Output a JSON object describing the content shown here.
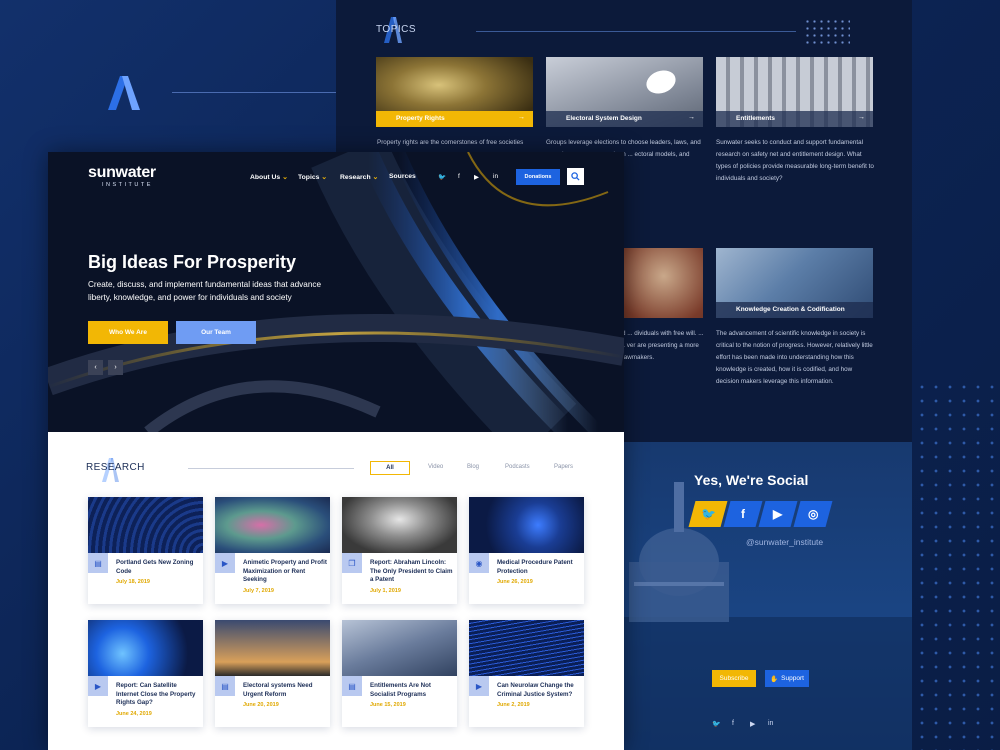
{
  "topics": {
    "heading": "TOPICS",
    "cards": [
      {
        "label": "Property Rights",
        "desc": "Property rights are the cornerstones of free societies"
      },
      {
        "label": "Electoral System Design",
        "desc": "Groups leverage elections to choose leaders, laws, and ... and sponsors research on ... ectoral models, and helps ... stems for the right"
      },
      {
        "label": "Entitlements",
        "desc": "Sunwater seeks to conduct and support fundamental research on safety net and entitlement design. What types of policies provide measurable long-term benefit to individuals and society?"
      },
      {
        "label": "",
        "desc": "... and sentencing are based ... dividuals with free will. ... psychology, genetics, and ... ver are presenting a more ... behavior that has ... and lawmakers."
      },
      {
        "label": "Knowledge Creation & Codification",
        "desc": "The advancement of scientific knowledge in society is critical to the notion of progress. However, relatively little effort has been made into understanding how this knowledge is created, how it is codified, and how decision makers leverage this information."
      }
    ]
  },
  "social": {
    "title": "Yes, We're Social",
    "handle": "@sunwater_institute",
    "subscribe": "Subscribe",
    "support": "Support",
    "buttons": [
      {
        "icon": "twitter-icon",
        "glyph": "🐦",
        "color": "#f2b705"
      },
      {
        "icon": "facebook-icon",
        "glyph": "f",
        "color": "#1d63e0"
      },
      {
        "icon": "youtube-icon",
        "glyph": "▶",
        "color": "#1d63e0"
      },
      {
        "icon": "instagram-icon",
        "glyph": "◎",
        "color": "#1d63e0"
      }
    ]
  },
  "site": {
    "logo_main": "sunwater",
    "logo_sub": "INSTITUTE",
    "nav": [
      "About Us",
      "Topics",
      "Research",
      "Sources"
    ],
    "donate": "Donations"
  },
  "hero": {
    "title": "Big Ideas For Prosperity",
    "subtitle": "Create, discuss, and implement fundamental ideas that advance liberty, knowledge, and power for individuals and society",
    "btn_primary": "Who We Are",
    "btn_secondary": "Our Team"
  },
  "research": {
    "heading": "RESEARCH",
    "filters": [
      "All",
      "Video",
      "Blog",
      "Podcasts",
      "Papers"
    ],
    "cards": [
      {
        "title": "Portland Gets New Zoning Code",
        "date": "July 18, 2019",
        "icon": "document-icon"
      },
      {
        "title": "Animetic Property and Profit Maximization or Rent Seeking",
        "date": "July 7, 2019",
        "icon": "play-icon"
      },
      {
        "title": "Report: Abraham Lincoln: The Only President to Claim a Patent",
        "date": "July 1, 2019",
        "icon": "copy-icon"
      },
      {
        "title": "Medical Procedure Patent Protection",
        "date": "June 26, 2019",
        "icon": "podcast-icon"
      },
      {
        "title": "Report: Can Satellite Internet Close the Property Rights Gap?",
        "date": "June 24, 2019",
        "icon": "play-icon"
      },
      {
        "title": "Electoral systems Need Urgent Reform",
        "date": "June 20, 2019",
        "icon": "document-icon"
      },
      {
        "title": "Entitlements Are Not Socialist Programs",
        "date": "June 15, 2019",
        "icon": "document-icon"
      },
      {
        "title": "Can Neurolaw Change the Criminal Justice System?",
        "date": "June 2, 2019",
        "icon": "play-icon"
      }
    ]
  },
  "colors": {
    "accent": "#f2b705",
    "blue": "#1d63e0",
    "navy": "#0c1a3a"
  }
}
